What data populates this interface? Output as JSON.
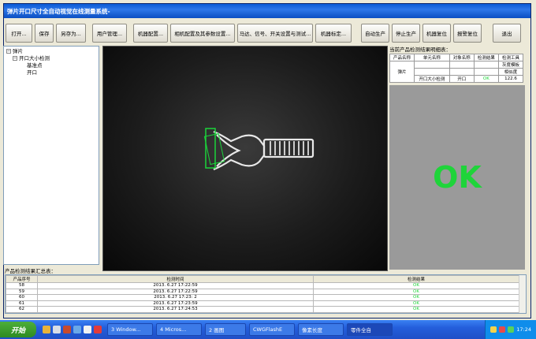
{
  "window": {
    "title": "弹片开口尺寸全自动视觉在线测量系统-"
  },
  "toolbar": {
    "buttons": [
      "打开...",
      "保存",
      "另存为...",
      "用户管理...",
      "机器配置...",
      "相机配置及其参数设置...",
      "马达、信号、开关设置与测试...",
      "机器标定...",
      "自动生产",
      "停止生产",
      "机器复位",
      "报警复位",
      "退出"
    ]
  },
  "tree": {
    "root": "弹片",
    "child": "开口大小检测",
    "leaves": [
      "基准点",
      "开口"
    ]
  },
  "details": {
    "label": "当前产品检测结果明细表：",
    "headers": [
      "产品名称",
      "单元名称",
      "对象名称",
      "检测结果",
      "检测工具"
    ],
    "product": "弹片",
    "tools": [
      "灰度模板",
      "相似度"
    ],
    "row": {
      "unit": "开口大小检测",
      "object": "开口",
      "result": "OK",
      "value": "122.6"
    }
  },
  "status": {
    "text": "OK",
    "color": "#1fd43a"
  },
  "summary": {
    "label": "产品检测结果汇总表：",
    "headers": [
      "产品序号",
      "检测时间",
      "检测结果"
    ],
    "rows": [
      {
        "id": "58",
        "time": "2013. 6.27 17:22:59",
        "result": "OK"
      },
      {
        "id": "59",
        "time": "2013. 6.27 17:22:59",
        "result": "OK"
      },
      {
        "id": "60",
        "time": "2013. 6.27 17:23: 2",
        "result": "OK"
      },
      {
        "id": "61",
        "time": "2013. 6.27 17:23:59",
        "result": "OK"
      },
      {
        "id": "62",
        "time": "2013. 6.27 17:24:53",
        "result": "OK"
      }
    ]
  },
  "taskbar": {
    "start": "开始",
    "tasks": [
      "3 Window...",
      "4 Micros...",
      "2 画图",
      "CWGFlashE",
      "像素长度",
      "零件全自"
    ],
    "clock": "17:24"
  }
}
